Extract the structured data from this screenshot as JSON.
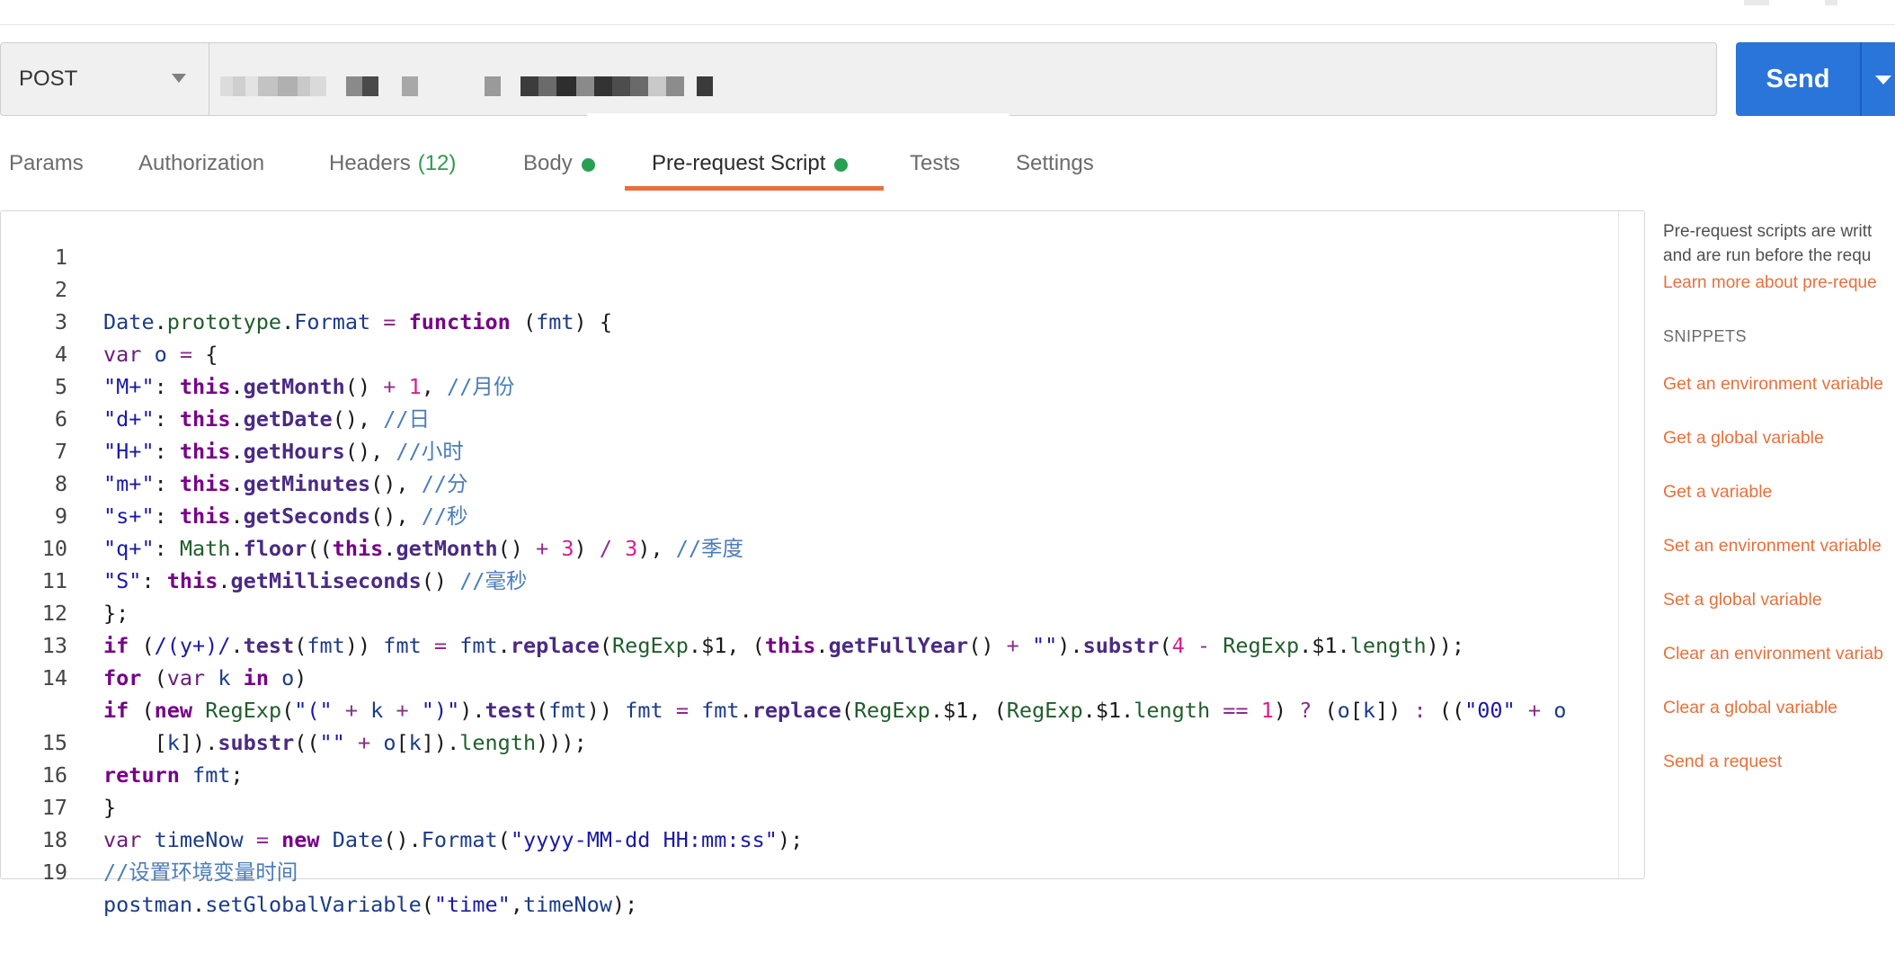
{
  "request": {
    "method": "POST",
    "send_label": "Send"
  },
  "tabs": [
    {
      "label": "Params"
    },
    {
      "label": "Authorization"
    },
    {
      "label": "Headers",
      "count": "(12)"
    },
    {
      "label": "Body"
    },
    {
      "label": "Pre-request Script"
    },
    {
      "label": "Tests"
    },
    {
      "label": "Settings"
    }
  ],
  "active_tab": "Pre-request Script",
  "colors": {
    "accent": "#e8703a",
    "send_button": "#2a75da",
    "dot": "#27a052"
  },
  "editor": {
    "line_numbers": [
      "1",
      "2",
      "3",
      "4",
      "5",
      "6",
      "7",
      "8",
      "9",
      "10",
      "11",
      "12",
      "13",
      "14",
      "",
      "15",
      "16",
      "17",
      "18",
      "19"
    ]
  },
  "sidebar": {
    "desc_line1": "Pre-request scripts are writt",
    "desc_line2": "and are run before the requ",
    "learn_more": "Learn more about pre-reque",
    "snippets_heading": "SNIPPETS",
    "snippets": [
      "Get an environment variable",
      "Get a global variable",
      "Get a variable",
      "Set an environment variable",
      "Set a global variable",
      "Clear an environment variab",
      "Clear a global variable",
      "Send a request"
    ]
  }
}
